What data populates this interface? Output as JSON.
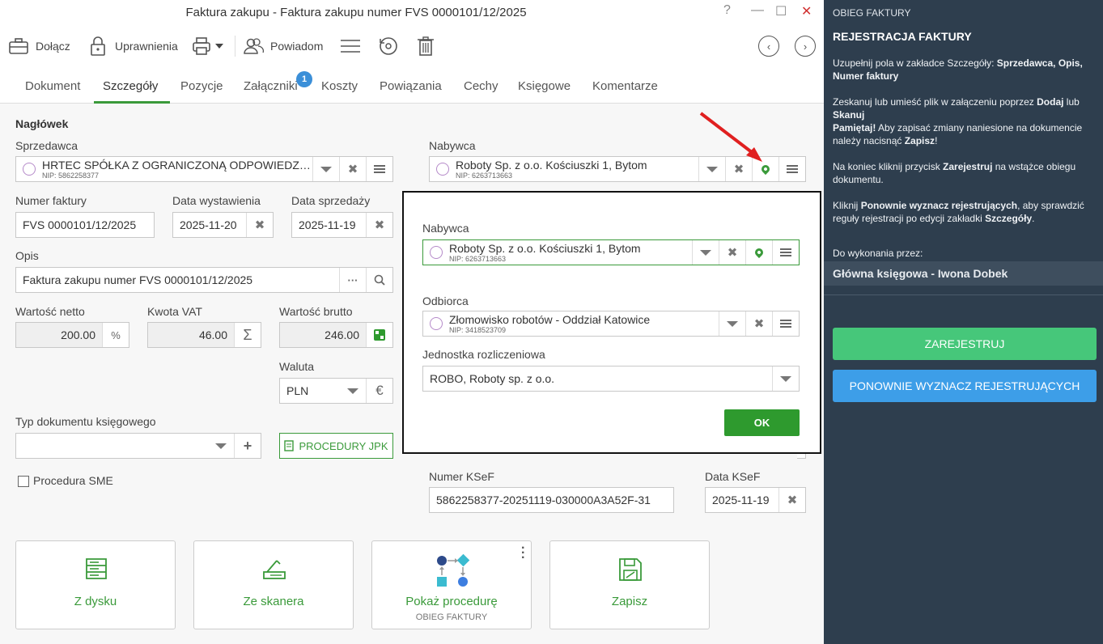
{
  "window": {
    "title": "Faktura zakupu - Faktura zakupu numer FVS 0000101/12/2025",
    "help": "?",
    "minimize": "—",
    "maximize": "☐",
    "close": "✕"
  },
  "toolbar": {
    "attach": "Dołącz",
    "permissions": "Uprawnienia",
    "notify": "Powiadom"
  },
  "tabs": {
    "items": [
      "Dokument",
      "Szczegóły",
      "Pozycje",
      "Załączniki",
      "Koszty",
      "Powiązania",
      "Cechy",
      "Księgowe",
      "Komentarze"
    ],
    "active": "Szczegóły",
    "attachments_badge": "1"
  },
  "form": {
    "header": "Nagłówek",
    "seller_label": "Sprzedawca",
    "seller_name": "HRTEC SPÓŁKA Z OGRANICZONĄ ODPOWIEDZIALNOŚCIĄ",
    "seller_nip": "NIP: 5862258377",
    "buyer_label": "Nabywca",
    "buyer_name": "Roboty Sp. z o.o. Kościuszki 1, Bytom",
    "buyer_nip": "NIP: 6263713663",
    "invoice_number_label": "Numer faktury",
    "invoice_number": "FVS 0000101/12/2025",
    "issue_date_label": "Data wystawienia",
    "issue_date": "2025-11-20",
    "sale_date_label": "Data sprzedaży",
    "sale_date": "2025-11-19",
    "description_label": "Opis",
    "description": "Faktura zakupu numer FVS 0000101/12/2025",
    "net_label": "Wartość netto",
    "net": "200.00",
    "vat_label": "Kwota VAT",
    "vat": "46.00",
    "gross_label": "Wartość brutto",
    "gross": "246.00",
    "currency_label": "Waluta",
    "currency": "PLN",
    "percent_symbol": "%",
    "sum_symbol": "Σ",
    "euro_symbol": "€",
    "doc_type_label": "Typ dokumentu księgowego",
    "doc_type": "",
    "jpk_button": "PROCEDURY JPK",
    "sme_label": "Procedura SME",
    "ksef_number_label": "Numer KSeF",
    "ksef_number": "5862258377-20251119-030000A3A52F-31",
    "ksef_date_label": "Data KSeF",
    "ksef_date": "2025-11-19"
  },
  "cards": [
    {
      "label": "Z dysku",
      "sub": ""
    },
    {
      "label": "Ze skanera",
      "sub": ""
    },
    {
      "label": "Pokaż procedurę",
      "sub": "OBIEG FAKTURY"
    },
    {
      "label": "Zapisz",
      "sub": ""
    }
  ],
  "popup": {
    "buyer_label": "Nabywca",
    "buyer_name": "Roboty Sp. z o.o. Kościuszki 1, Bytom",
    "buyer_nip": "NIP: 6263713663",
    "recipient_label": "Odbiorca",
    "recipient_name": "Złomowisko robotów - Oddział Katowice",
    "recipient_nip": "NIP: 3418523709",
    "unit_label": "Jednostka rozliczeniowa",
    "unit": "ROBO, Roboty sp. z o.o.",
    "ok": "OK"
  },
  "panel": {
    "title": "OBIEG FAKTURY",
    "subtitle": "REJESTRACJA FAKTURY",
    "p1_a": "Uzupełnij pola w zakładce Szczegóły: ",
    "p1_b": "Sprzedawca, Opis, Numer faktury",
    "p2_a": "Zeskanuj lub umieść plik w załączeniu poprzez ",
    "p2_b": "Dodaj",
    "p2_c": " lub ",
    "p2_d": "Skanuj",
    "p2_e": "Pamiętaj!",
    "p2_f": " Aby zapisać zmiany naniesione na dokumencie należy nacisnąć ",
    "p2_g": "Zapisz",
    "p2_h": "!",
    "p3_a": "Na koniec kliknij przycisk ",
    "p3_b": "Zarejestruj",
    "p3_c": " na wstążce obiegu dokumentu.",
    "p4_a": "Kliknij ",
    "p4_b": "Ponownie wyznacz rejestrujących",
    "p4_c": ", aby sprawdzić reguły rejestracji po edycji zakładki ",
    "p4_d": "Szczegóły",
    "p4_e": ".",
    "todo_label": "Do wykonania przez:",
    "assignee": "Główna księgowa - Iwona Dobek",
    "register_button": "ZAREJESTRUJ",
    "reassign_button": "PONOWNIE WYZNACZ REJESTRUJĄCYCH"
  },
  "colors": {
    "accent_green": "#3a9a3a",
    "panel_bg": "#2e3e4e",
    "register_green": "#46c77a",
    "reassign_blue": "#3d9ee8",
    "ok_green": "#2e9a2e",
    "badge_blue": "#3b8fd8",
    "arrow_red": "#e02020"
  }
}
